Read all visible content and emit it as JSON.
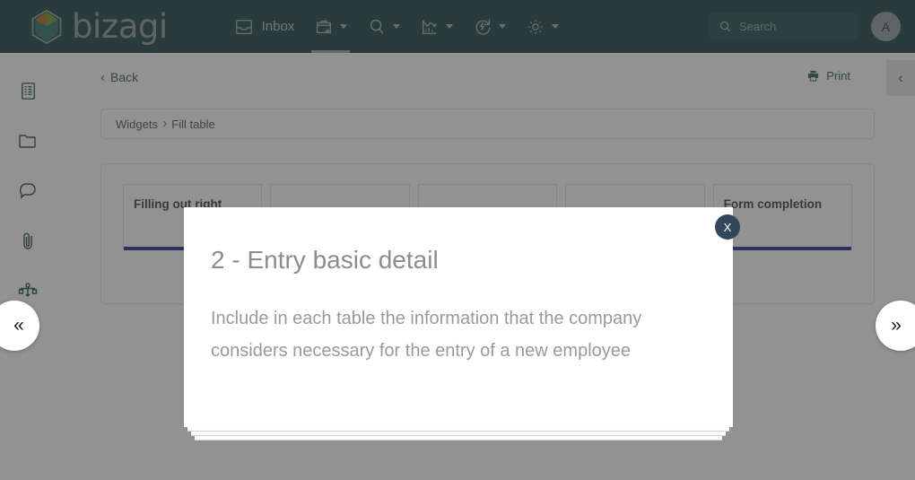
{
  "brand": {
    "name": "bizagi",
    "logo_icon": "bizagi-hexagon-logo",
    "header_bg": "#17423f",
    "accent_blue": "#1b2f8c"
  },
  "topnav": {
    "items": [
      {
        "label": "Inbox",
        "icon": "inbox-tray-icon",
        "has_caret": false,
        "active": false
      },
      {
        "label": "",
        "icon": "briefcase-plus-icon",
        "has_caret": true,
        "active": true
      },
      {
        "label": "",
        "icon": "search-magnifier-icon",
        "has_caret": true,
        "active": false
      },
      {
        "label": "",
        "icon": "analytics-chart-icon",
        "has_caret": true,
        "active": false
      },
      {
        "label": "",
        "icon": "refresh-bolt-icon",
        "has_caret": true,
        "active": false
      },
      {
        "label": "",
        "icon": "gear-settings-icon",
        "has_caret": true,
        "active": false
      }
    ],
    "search": {
      "placeholder": "Search",
      "value": "",
      "icon": "search-icon"
    },
    "avatar": {
      "initial": "A"
    }
  },
  "rail": {
    "items": [
      {
        "icon": "document-list-icon",
        "name": "summary"
      },
      {
        "icon": "folder-icon",
        "name": "documents"
      },
      {
        "icon": "comment-bubble-icon",
        "name": "comments"
      },
      {
        "icon": "paperclip-icon",
        "name": "attachments"
      },
      {
        "icon": "process-flow-icon",
        "name": "process"
      }
    ],
    "collapse_glyph": "«",
    "expand_glyph": "»"
  },
  "page": {
    "back_label": "Back",
    "back_icon": "chevron-left-icon",
    "print_label": "Print",
    "print_icon": "printer-icon",
    "collapse_right_glyph": "‹",
    "breadcrumb": {
      "root": "Widgets",
      "separator": "›",
      "current": "Fill table"
    }
  },
  "tabs": [
    {
      "label": "Filling out right",
      "completed": true
    },
    {
      "label": "",
      "completed": false
    },
    {
      "label": "",
      "completed": false
    },
    {
      "label": "",
      "completed": false
    },
    {
      "label": "Form completion",
      "completed": true
    }
  ],
  "modal": {
    "title": "2 - Entry basic detail",
    "body": "Include in each table the information that the company considers necessary for the entry of a new employee",
    "close_label": "X",
    "close_icon": "close-x-icon"
  }
}
